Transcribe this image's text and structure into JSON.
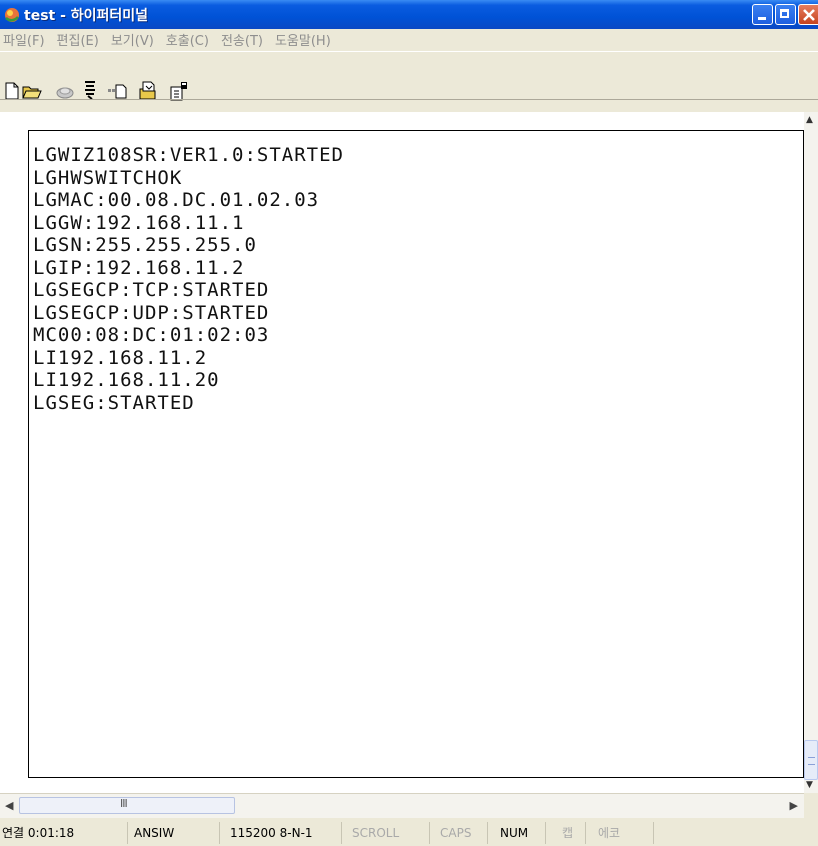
{
  "window": {
    "title": "test - 하이퍼터미널"
  },
  "menu": [
    {
      "label": "파일(F)"
    },
    {
      "label": "편집(E)"
    },
    {
      "label": "보기(V)"
    },
    {
      "label": "호출(C)"
    },
    {
      "label": "전송(T)"
    },
    {
      "label": "도움말(H)"
    }
  ],
  "toolbar": {
    "icons": [
      "new-document-icon",
      "open-folder-icon",
      "connect-phone-icon",
      "disconnect-icon",
      "send-file-icon",
      "receive-file-icon",
      "properties-icon"
    ]
  },
  "terminal": {
    "lines": [
      "LGWIZ108SR:VER1.0:STARTED",
      "LGHWSWITCHOK",
      "LGMAC:00.08.DC.01.02.03",
      "LGGW:192.168.11.1",
      "LGSN:255.255.255.0",
      "LGIP:192.168.11.2",
      "LGSEGCP:TCP:STARTED",
      "LGSEGCP:UDP:STARTED",
      "MC00:08:DC:01:02:03",
      "LI192.168.11.2",
      "LI192.168.11.20",
      "LGSEG:STARTED"
    ]
  },
  "statusbar": {
    "connection": "연결 0:01:18",
    "emulation": "ANSIW",
    "port_settings": "115200 8-N-1",
    "scroll": "SCROLL",
    "caps": "CAPS",
    "num": "NUM",
    "capture": "캡",
    "echo": "에코"
  },
  "colors": {
    "titlebar": "#0052d6",
    "frame": "#ece9d8",
    "disabled_text": "#a9a9a9"
  }
}
